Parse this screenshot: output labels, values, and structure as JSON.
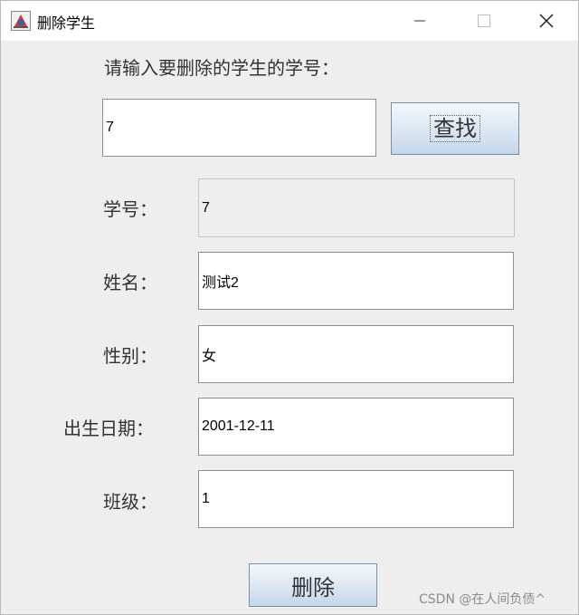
{
  "window": {
    "title": "删除学生",
    "icon": "java-app-icon",
    "controls": [
      "minimize-icon",
      "maximize-icon",
      "close-icon"
    ]
  },
  "search": {
    "prompt": "请输入要删除的学生的学号：",
    "input_value": "7",
    "button_label": "查找"
  },
  "form": {
    "fields": [
      {
        "label": "学号：",
        "value": "7",
        "readonly": true
      },
      {
        "label": "姓名：",
        "value": "测试2"
      },
      {
        "label": "性别：",
        "value": "女"
      },
      {
        "label": "出生日期：",
        "value": "2001-12-11"
      },
      {
        "label": "班级：",
        "value": "1"
      }
    ]
  },
  "actions": {
    "delete_label": "删除"
  },
  "watermark": "CSDN @在人间负债^"
}
